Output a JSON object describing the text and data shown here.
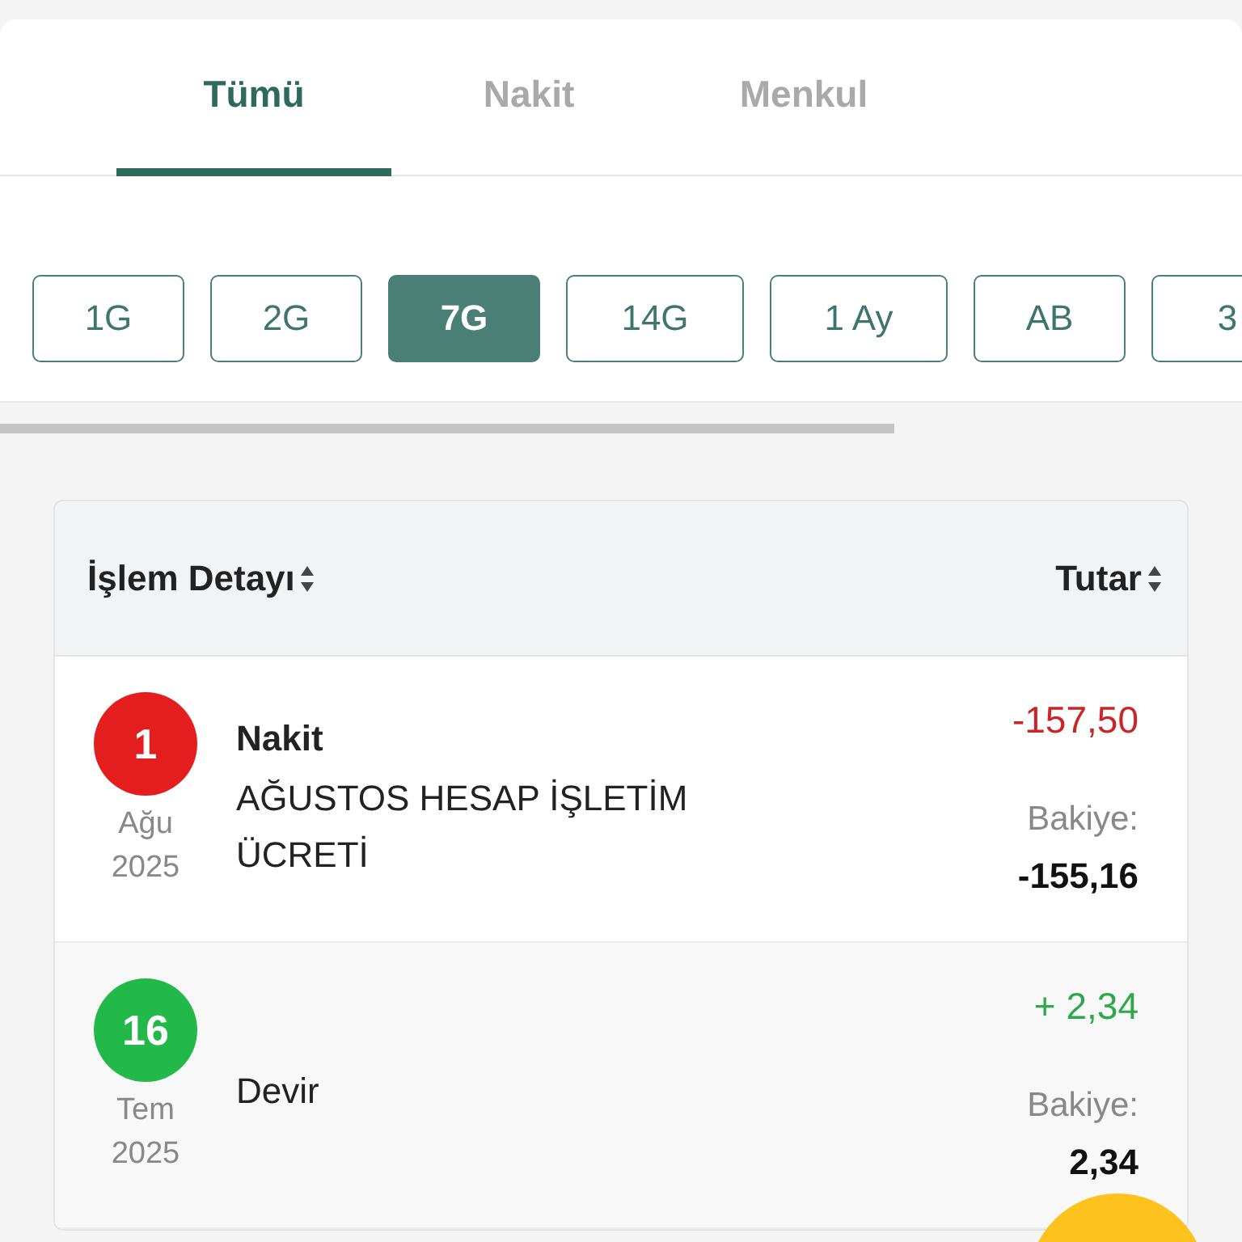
{
  "tabs": [
    {
      "label": "Tümü",
      "selected": true
    },
    {
      "label": "Nakit",
      "selected": false
    },
    {
      "label": "Menkul",
      "selected": false
    }
  ],
  "periods": [
    {
      "label": "1G",
      "selected": false
    },
    {
      "label": "2G",
      "selected": false
    },
    {
      "label": "7G",
      "selected": true
    },
    {
      "label": "14G",
      "selected": false
    },
    {
      "label": "1 Ay",
      "selected": false
    },
    {
      "label": "AB",
      "selected": false
    },
    {
      "label": "3",
      "selected": false
    }
  ],
  "table": {
    "columns": [
      "İşlem Detayı",
      "Tutar"
    ],
    "rows": [
      {
        "day": "1",
        "month": "Ağu",
        "year": "2025",
        "color": "#e41e1e",
        "title": "Nakit",
        "description": "AĞUSTOS HESAP İŞLETİM ÜCRETİ",
        "kind": "debit",
        "amount": "-157,50",
        "balance_label": "Bakiye:",
        "balance": "-155,16"
      },
      {
        "day": "16",
        "month": "Tem",
        "year": "2025",
        "color": "#22b84a",
        "description": "Devir",
        "kind": "credit",
        "amount": "+ 2,34",
        "balance_label": "Bakiye:",
        "balance": "2,34"
      }
    ]
  }
}
